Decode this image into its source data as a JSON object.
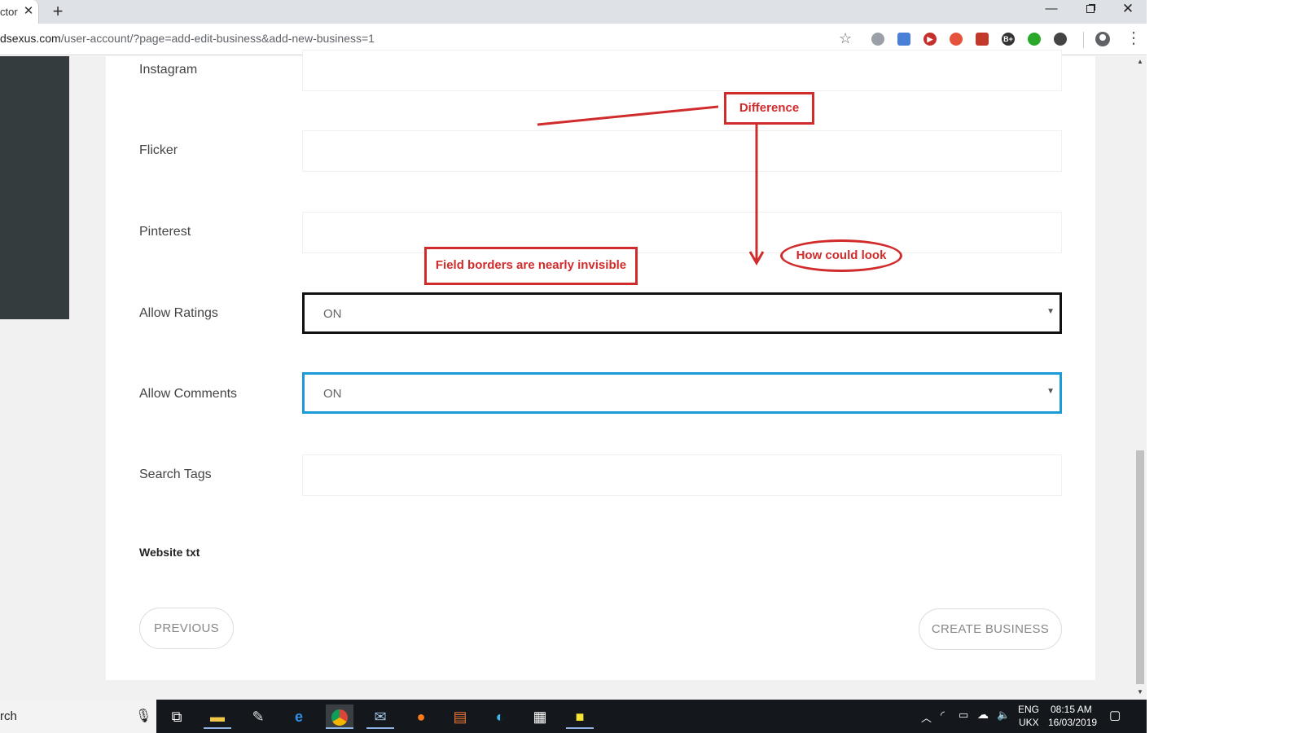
{
  "browser": {
    "tab_title": "ctor",
    "tab_close": "✕",
    "new_tab": "+",
    "url_domain": "dsexus.com",
    "url_path": "/user-account/?page=add-edit-business&add-new-business=1",
    "window_minimize": "—",
    "window_close": "✕",
    "extensions": [
      {
        "icon": "shield-ext-icon",
        "color": "#9aa0a6"
      },
      {
        "icon": "translate-ext-icon",
        "color": "#4a7fd6"
      },
      {
        "icon": "youtube-ext-icon",
        "color": "#c4302b"
      },
      {
        "icon": "privacy-badger-ext-icon",
        "color": "#e5533d"
      },
      {
        "icon": "ublock-ext-icon",
        "color": "#c0392b"
      },
      {
        "icon": "b-plus-ext-icon",
        "color": "#333333",
        "text": "B+"
      },
      {
        "icon": "green-ext-icon",
        "color": "#2aa82a"
      },
      {
        "icon": "dark-ext-icon",
        "color": "#444444"
      }
    ]
  },
  "form": {
    "fields": [
      {
        "label": "Instagram"
      },
      {
        "label": "Flicker"
      },
      {
        "label": "Pinterest"
      }
    ],
    "allow_ratings": {
      "label": "Allow Ratings",
      "value": "ON"
    },
    "allow_comments": {
      "label": "Allow Comments",
      "value": "ON"
    },
    "search_tags": {
      "label": "Search Tags"
    },
    "website_label": "Website txt",
    "select_arrow": "▼",
    "buttons": {
      "previous": "PREVIOUS",
      "create": "CREATE BUSINESS"
    }
  },
  "annotations": {
    "difference": "Difference",
    "invisible": "Field borders are nearly invisible",
    "how_could_look": "How could look",
    "color": "#d12c2c"
  },
  "taskbar": {
    "search_text": "rch",
    "language": "ENG",
    "region": "UKX",
    "time": "08:15 AM",
    "date": "16/03/2019"
  },
  "colors": {
    "accent_blue": "#1a9ad6",
    "sidebar_dark": "#353c3e"
  }
}
